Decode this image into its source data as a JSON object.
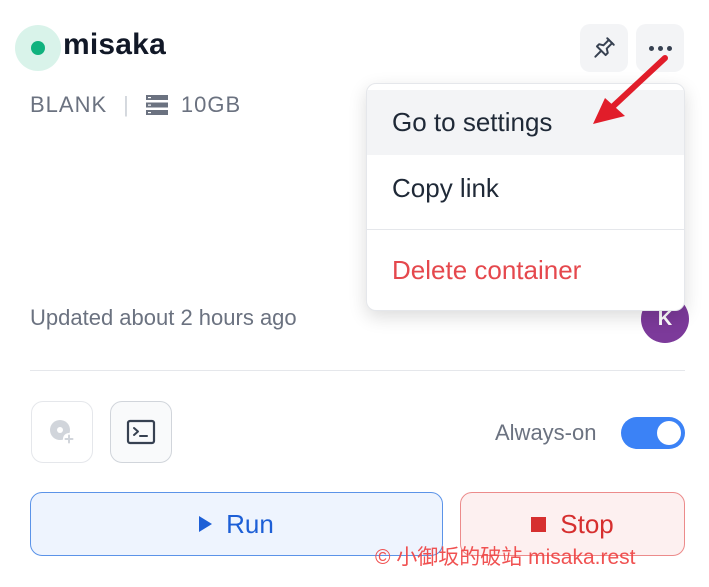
{
  "container": {
    "name": "misaka",
    "status_color": "#10b27e",
    "template": "BLANK",
    "storage": "10GB",
    "storage_icon": "database-icon",
    "updated": "Updated about 2 hours ago",
    "avatar_initial": "K",
    "avatar_color": "#7c3a9a"
  },
  "header": {
    "pin_icon": "pin-icon",
    "more_icon": "more-horizontal-icon"
  },
  "menu": {
    "items": [
      {
        "label": "Go to settings",
        "highlighted": true
      },
      {
        "label": "Copy link"
      },
      {
        "label": "Delete container",
        "color": "#e5484d"
      }
    ]
  },
  "tools": {
    "disk_icon": "add-disk-icon",
    "terminal_icon": "terminal-icon",
    "always_on_label": "Always-on",
    "always_on": true,
    "toggle_color": "#3b82f6"
  },
  "actions": {
    "run_label": "Run",
    "stop_label": "Stop"
  },
  "watermark": "© 小御坂的破站 misaka.rest",
  "annotation": {
    "arrow_color": "#e11d2a"
  }
}
